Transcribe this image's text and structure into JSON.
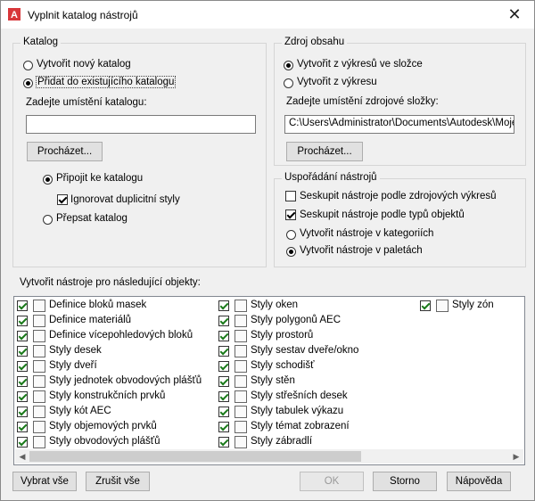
{
  "dialog": {
    "title": "Vyplnit katalog nástrojů",
    "close_glyph": "✕"
  },
  "catalog": {
    "group_title": "Katalog",
    "radio_new": "Vytvořit nový katalog",
    "radio_add": "Přidat do existujícího katalogu",
    "location_label": "Zadejte umístění katalogu:",
    "location_value": "",
    "browse_label": "Procházet...",
    "radio_attach": "Připojit ke katalogu",
    "check_ignore": "Ignorovat duplicitní styly",
    "radio_overwrite": "Přepsat katalog"
  },
  "source": {
    "group_title": "Zdroj obsahu",
    "radio_folder": "Vytvořit z výkresů ve složce",
    "radio_drawing": "Vytvořit z výkresu",
    "folder_label": "Zadejte umístění zdrojové složky:",
    "folder_value": "C:\\Users\\Administrator\\Documents\\Autodesk\\Moje p",
    "browse_label": "Procházet..."
  },
  "arrangement": {
    "group_title": "Uspořádání nástrojů",
    "check_by_drawing": "Seskupit nástroje podle zdrojových výkresů",
    "check_by_type": "Seskupit nástroje podle typů objektů",
    "radio_categories": "Vytvořit nástroje v kategoriích",
    "radio_palettes": "Vytvořit nástroje v paletách"
  },
  "objects": {
    "label": "Vytvořit nástroje pro následující objekty:",
    "col1": [
      "Definice bloků masek",
      "Definice materiálů",
      "Definice vícepohledových bloků",
      "Styly desek",
      "Styly dveří",
      "Styly jednotek obvodových plášťů",
      "Styly konstrukčních prvků",
      "Styly kót AEC",
      "Styly objemových prvků",
      "Styly obvodových plášťů"
    ],
    "col2": [
      "Styly oken",
      "Styly polygonů AEC",
      "Styly prostorů",
      "Styly sestav dveře/okno",
      "Styly schodišť",
      "Styly stěn",
      "Styly střešních desek",
      "Styly tabulek výkazu",
      "Styly témat zobrazení",
      "Styly zábradlí"
    ],
    "col3": [
      "Styly zón"
    ]
  },
  "buttons": {
    "select_all": "Vybrat vše",
    "deselect_all": "Zrušit vše",
    "ok": "OK",
    "cancel": "Storno",
    "help": "Nápověda"
  },
  "colors": {
    "check_green": "#1a7a1a",
    "disabled_text": "#9a9a9a"
  }
}
